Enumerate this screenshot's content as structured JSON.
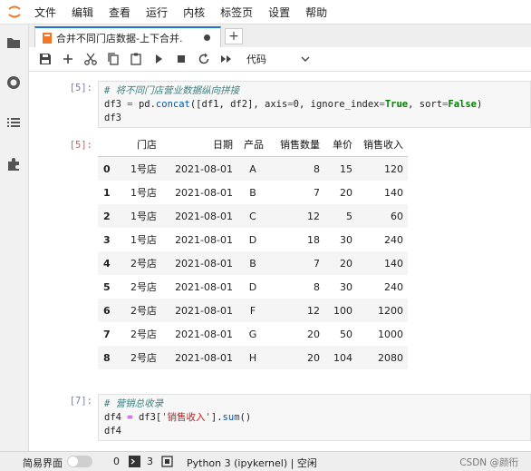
{
  "menubar": {
    "items": [
      "文件",
      "编辑",
      "查看",
      "运行",
      "内核",
      "标签页",
      "设置",
      "帮助"
    ]
  },
  "tab": {
    "title": "合并不同门店数据-上下合并.",
    "add_label": "+"
  },
  "toolbar": {
    "cell_type": "代码",
    "buttons": [
      "save-icon",
      "add-icon",
      "cut-icon",
      "copy-icon",
      "paste-icon",
      "run-icon",
      "stop-icon",
      "restart-icon",
      "fast-forward-icon"
    ]
  },
  "cells": {
    "in5": {
      "prompt": "[5]:",
      "line1": "# 将不同门店营业数据纵向拼接",
      "line2_a": "df3 ",
      "line2_eq": "=",
      "line2_b": " pd.",
      "line2_fn": "concat",
      "line2_c": "([df1, df2], axis",
      "line2_eq2": "=",
      "line2_d": "0, ignore_index",
      "line2_eq3": "=",
      "line2_true": "True",
      "line2_e": ", sort",
      "line2_eq4": "=",
      "line2_false": "False",
      "line2_f": ")",
      "line3": "df3"
    },
    "out5": {
      "prompt": "[5]:",
      "columns": [
        "",
        "门店",
        "日期",
        "产品",
        "销售数量",
        "单价",
        "销售收入"
      ],
      "rows": [
        [
          "0",
          "1号店",
          "2021-08-01",
          "A",
          "8",
          "15",
          "120"
        ],
        [
          "1",
          "1号店",
          "2021-08-01",
          "B",
          "7",
          "20",
          "140"
        ],
        [
          "2",
          "1号店",
          "2021-08-01",
          "C",
          "12",
          "5",
          "60"
        ],
        [
          "3",
          "1号店",
          "2021-08-01",
          "D",
          "18",
          "30",
          "240"
        ],
        [
          "4",
          "2号店",
          "2021-08-01",
          "B",
          "7",
          "20",
          "140"
        ],
        [
          "5",
          "2号店",
          "2021-08-01",
          "D",
          "8",
          "30",
          "240"
        ],
        [
          "6",
          "2号店",
          "2021-08-01",
          "F",
          "12",
          "100",
          "1200"
        ],
        [
          "7",
          "2号店",
          "2021-08-01",
          "G",
          "20",
          "50",
          "1000"
        ],
        [
          "8",
          "2号店",
          "2021-08-01",
          "H",
          "20",
          "104",
          "2080"
        ]
      ]
    },
    "in7": {
      "prompt": "[7]:",
      "line1": "# 营销总收录",
      "line2_a": "df4 ",
      "line2_eq": "=",
      "line2_b": " df3[",
      "line2_str": "'销售收入'",
      "line2_c": "].",
      "line2_fn": "sum",
      "line2_d": "()",
      "line3": "df4"
    }
  },
  "statusbar": {
    "simple_mode": "简易界面",
    "count_a": "0",
    "count_b": "3",
    "kernel": "Python 3 (ipykernel) | 空闲",
    "watermark": "CSDN @颜衎"
  },
  "colors": {
    "accent": "#1976d2",
    "logo": "#f37726"
  }
}
